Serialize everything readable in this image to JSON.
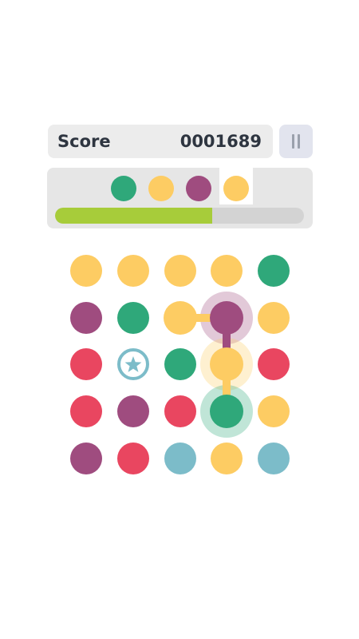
{
  "header": {
    "score_label": "Score",
    "score_value": "0001689",
    "pause_icon": "pause-icon"
  },
  "goal": {
    "target_colors": [
      "#2fa87a",
      "#fdcc63",
      "#9f4c7f",
      "#fdcc63"
    ],
    "highlighted_index": 3,
    "progress_fraction": 0.63
  },
  "colors": {
    "green": "#2fa87a",
    "yellow": "#fdcc63",
    "purple": "#9f4c7f",
    "red": "#e94660",
    "teal": "#7cbcc9",
    "star_icon_color": "#7cbcc9"
  },
  "board": {
    "rows": [
      [
        "yellow",
        "yellow",
        "yellow",
        "yellow",
        "green"
      ],
      [
        "purple",
        "green",
        "yellow",
        "purple",
        "yellow"
      ],
      [
        "red",
        "star",
        "green",
        "yellow",
        "red"
      ],
      [
        "red",
        "purple",
        "red",
        "green",
        "yellow"
      ],
      [
        "purple",
        "red",
        "teal",
        "yellow",
        "teal"
      ]
    ],
    "selected_path": [
      [
        1,
        2
      ],
      [
        1,
        3
      ],
      [
        2,
        3
      ],
      [
        3,
        3
      ]
    ]
  }
}
